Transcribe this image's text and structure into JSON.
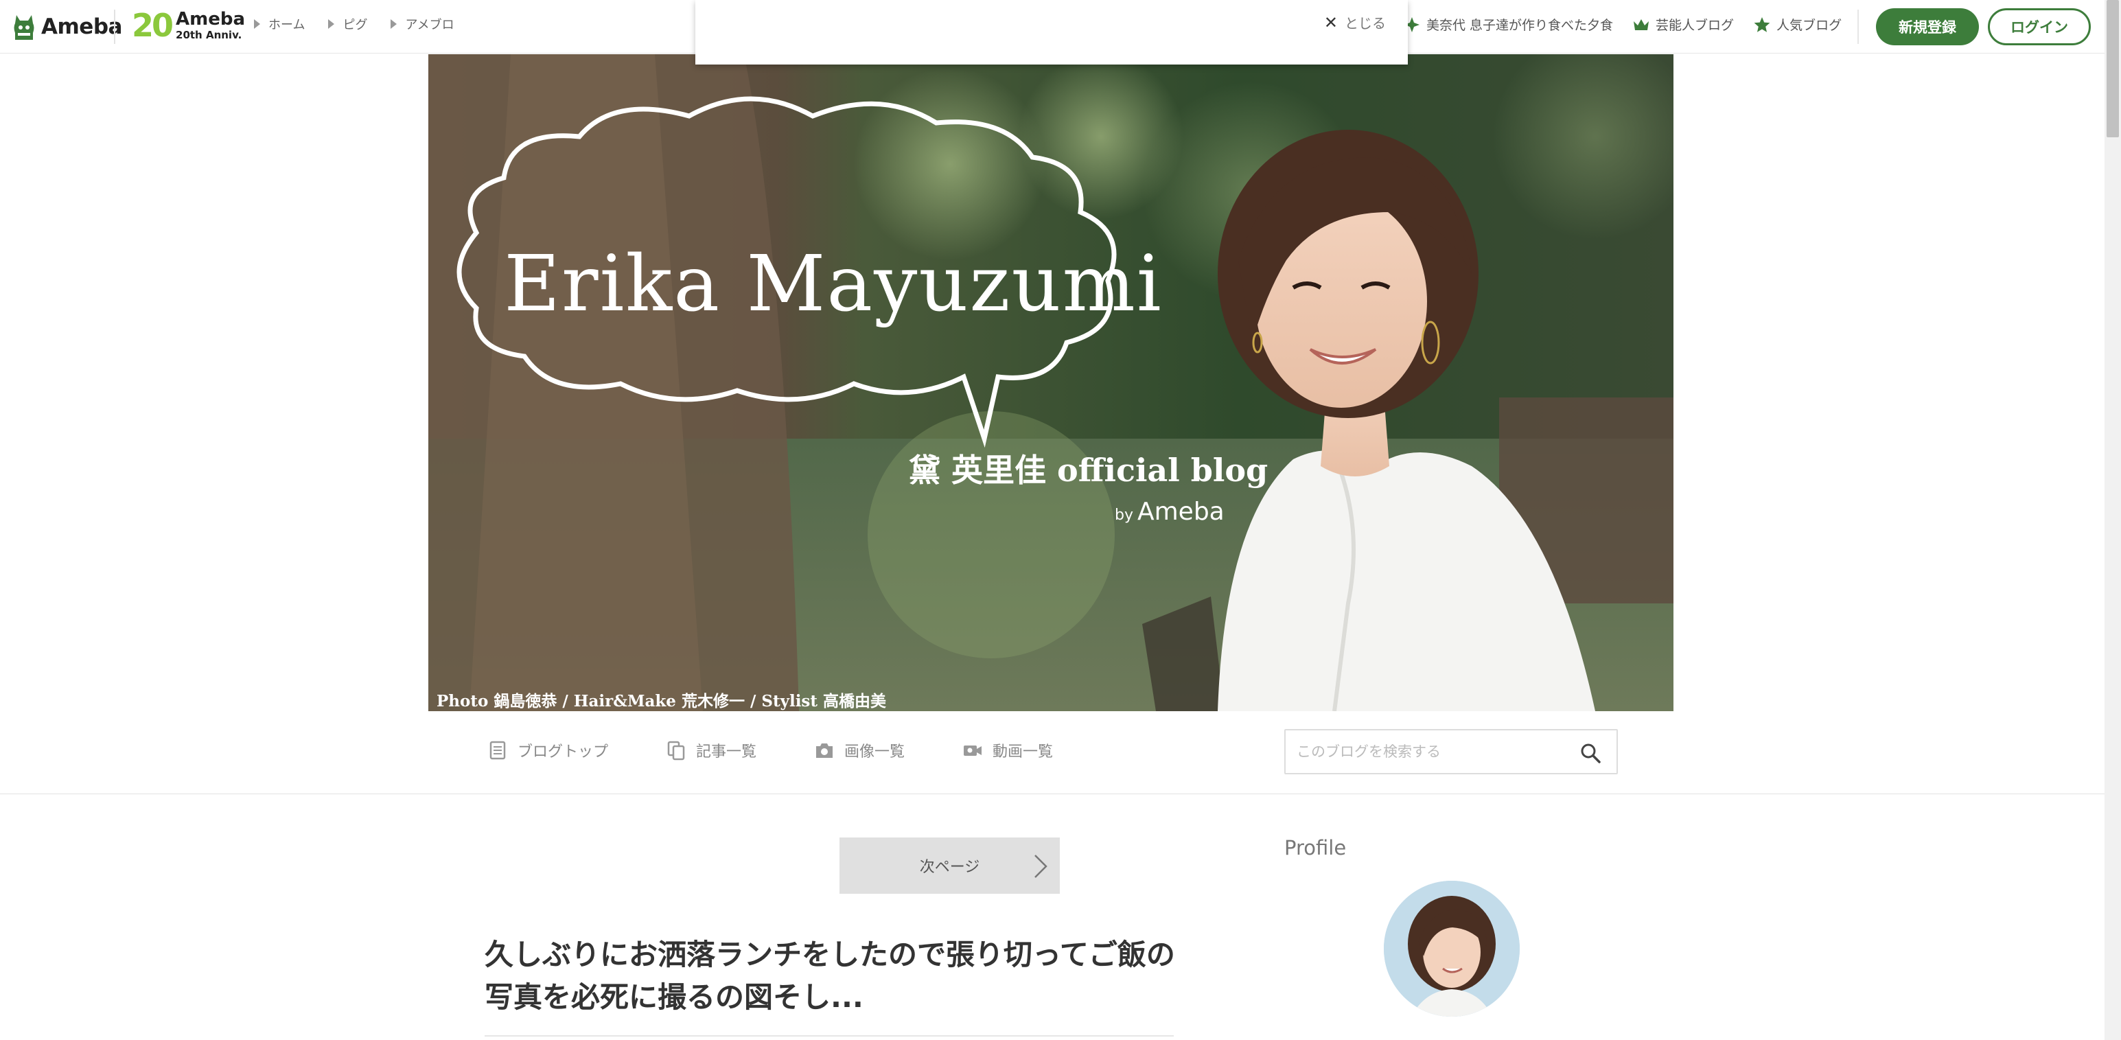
{
  "header": {
    "logo_text": "Ameba",
    "anniv_number": "20",
    "anniv_title": "Ameba",
    "anniv_sub": "20th Anniv.",
    "nav": [
      "ホーム",
      "ピグ",
      "アメブロ"
    ],
    "trending": [
      {
        "label": "美奈代 息子達が作り食べた夕食",
        "icon": "sparkle-icon"
      },
      {
        "label": "芸能人ブログ",
        "icon": "crown-icon"
      },
      {
        "label": "人気ブログ",
        "icon": "star-icon"
      }
    ],
    "signup_label": "新規登録",
    "login_label": "ログイン",
    "accent": "#3d7d3b"
  },
  "notice": {
    "close_label": "とじる"
  },
  "hero": {
    "name_text": "Erika Mayuzumi",
    "sub_text": "黛 英里佳 official blog",
    "by_text": "by",
    "by_brand": "Ameba",
    "credit": "Photo 鍋島徳恭 / Hair&Make 荒木修一 / Stylist 高橋由美"
  },
  "blognav": {
    "tabs": [
      {
        "label": "ブログトップ",
        "icon": "document-icon"
      },
      {
        "label": "記事一覧",
        "icon": "copy-icon"
      },
      {
        "label": "画像一覧",
        "icon": "camera-icon"
      },
      {
        "label": "動画一覧",
        "icon": "video-icon"
      }
    ],
    "search_placeholder": "このブログを検索する"
  },
  "main": {
    "next_label": "次ページ",
    "post_title": "久しぶりにお洒落ランチをしたので張り切ってご飯の写真を必死に撮るの図そし..."
  },
  "sidebar": {
    "heading": "Profile"
  }
}
